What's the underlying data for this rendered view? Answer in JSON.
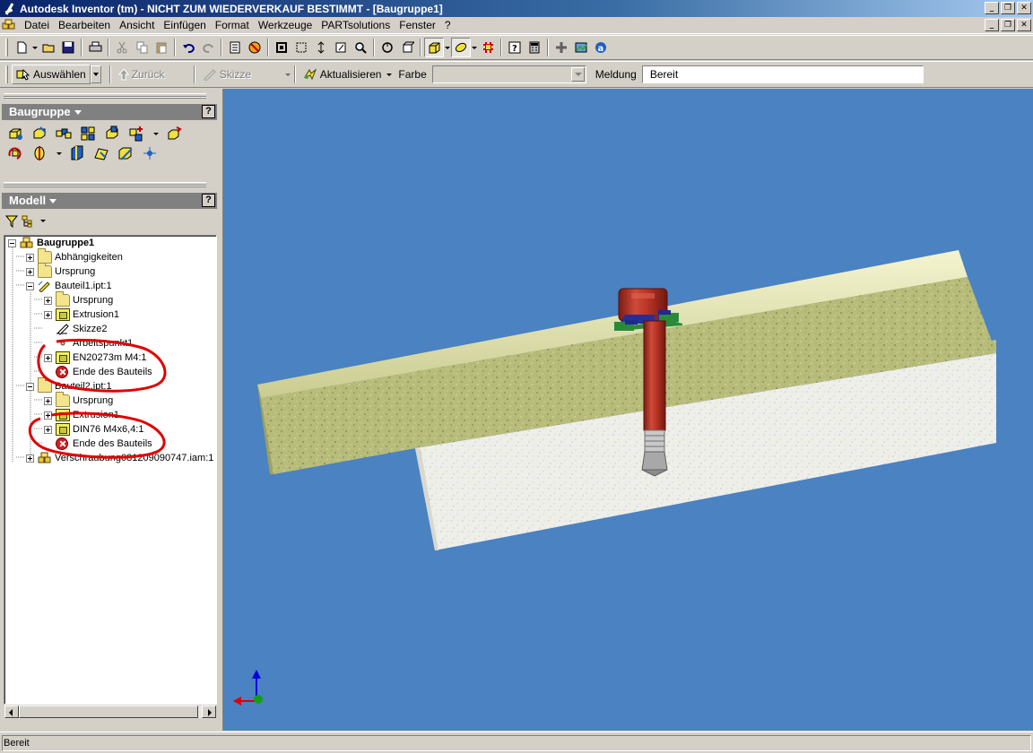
{
  "window": {
    "title": "Autodesk Inventor (tm) - NICHT ZUM WIEDERVERKAUF BESTIMMT - [Baugruppe1]",
    "controls": [
      "_",
      "❐",
      "✕"
    ]
  },
  "menu": {
    "items": [
      "Datei",
      "Bearbeiten",
      "Ansicht",
      "Einfügen",
      "Format",
      "Werkzeuge",
      "PARTsolutions",
      "Fenster",
      "?"
    ]
  },
  "toolbar2": {
    "select_label": "Auswählen",
    "back_label": "Zurück",
    "sketch_label": "Skizze",
    "update_label": "Aktualisieren",
    "color_label": "Farbe",
    "color_value": "",
    "message_label": "Meldung",
    "message_value": "Bereit"
  },
  "panels": {
    "assembly_title": "Baugruppe",
    "model_title": "Modell",
    "help": "?",
    "close": "×"
  },
  "tree": {
    "root": "Baugruppe1",
    "items": [
      "Abhängigkeiten",
      "Ursprung",
      "Bauteil1.ipt:1",
      "Ursprung",
      "Extrusion1",
      "Skizze2",
      "Arbeitspunkt1",
      "EN20273m M4:1",
      "Ende des Bauteils",
      "Bauteil2.ipt:1",
      "Ursprung",
      "Extrusion1",
      "DIN76 M4x6,4:1",
      "Ende des Bauteils",
      "Verschraubung081209090747.iam:1"
    ]
  },
  "status": {
    "text": "Bereit"
  },
  "colors": {
    "viewport_bg": "#4a82c2",
    "annotation": "#e00000",
    "titlebar": "#0a246a"
  }
}
